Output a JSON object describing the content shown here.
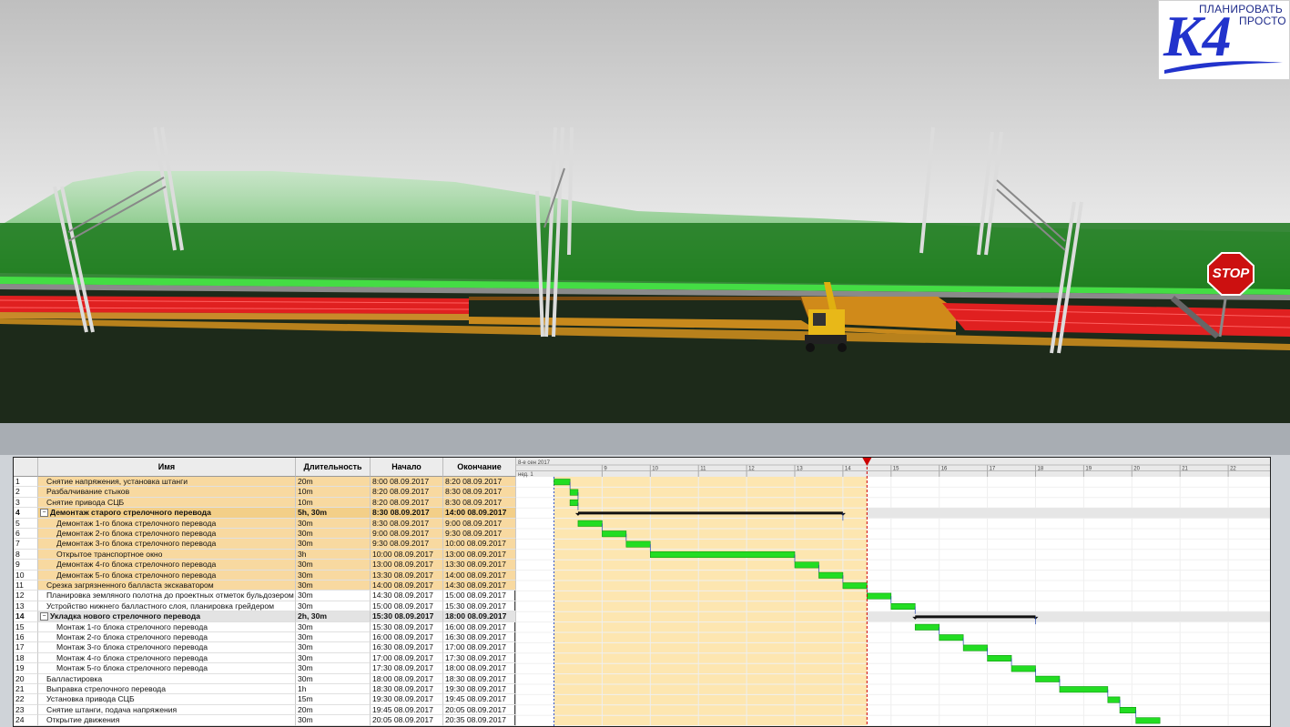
{
  "logo": {
    "line1": "ПЛАНИРОВАТЬ",
    "line2": "ПРОСТО",
    "mark": "K4"
  },
  "scene": {
    "sign_text": "STOP"
  },
  "columns": {
    "name": "Имя",
    "duration": "Длительность",
    "start": "Начало",
    "finish": "Окончание"
  },
  "timeline": {
    "date_label": "8-е сен 2017",
    "week_label": "нед. 1",
    "hours": [
      "9",
      "10",
      "11",
      "12",
      "13",
      "14",
      "15",
      "16",
      "17",
      "18",
      "19",
      "20",
      "21",
      "22"
    ]
  },
  "colors": {
    "past_band": "#fde6b0",
    "task_bar": "#22dd22",
    "summary_bar": "#111111",
    "today_line": "#cc0000"
  },
  "tasks": [
    {
      "id": "1",
      "name": "Снятие напряжения, установка штанги",
      "duration": "20m",
      "start": "8:00 08.09.2017",
      "finish": "8:20 08.09.2017",
      "level": 1,
      "summary": false,
      "past": true,
      "s": 0,
      "e": 20
    },
    {
      "id": "2",
      "name": "Разбалчивание стыков",
      "duration": "10m",
      "start": "8:20 08.09.2017",
      "finish": "8:30 08.09.2017",
      "level": 1,
      "summary": false,
      "past": true,
      "s": 20,
      "e": 30
    },
    {
      "id": "3",
      "name": "Снятие привода СЦБ",
      "duration": "10m",
      "start": "8:20 08.09.2017",
      "finish": "8:30 08.09.2017",
      "level": 1,
      "summary": false,
      "past": true,
      "s": 20,
      "e": 30
    },
    {
      "id": "4",
      "name": "Демонтаж старого стрелочного перевода",
      "duration": "5h, 30m",
      "start": "8:30 08.09.2017",
      "finish": "14:00 08.09.2017",
      "level": 0,
      "summary": true,
      "past": true,
      "s": 30,
      "e": 360
    },
    {
      "id": "5",
      "name": "Демонтаж 1-го блока стрелочного перевода",
      "duration": "30m",
      "start": "8:30 08.09.2017",
      "finish": "9:00 08.09.2017",
      "level": 2,
      "summary": false,
      "past": true,
      "s": 30,
      "e": 60
    },
    {
      "id": "6",
      "name": "Демонтаж 2-го блока стрелочного перевода",
      "duration": "30m",
      "start": "9:00 08.09.2017",
      "finish": "9:30 08.09.2017",
      "level": 2,
      "summary": false,
      "past": true,
      "s": 60,
      "e": 90
    },
    {
      "id": "7",
      "name": "Демонтаж 3-го блока стрелочного перевода",
      "duration": "30m",
      "start": "9:30 08.09.2017",
      "finish": "10:00 08.09.2017",
      "level": 2,
      "summary": false,
      "past": true,
      "s": 90,
      "e": 120
    },
    {
      "id": "8",
      "name": "Открытое транспортное окно",
      "duration": "3h",
      "start": "10:00 08.09.2017",
      "finish": "13:00 08.09.2017",
      "level": 2,
      "summary": false,
      "past": true,
      "s": 120,
      "e": 300
    },
    {
      "id": "9",
      "name": "Демонтаж 4-го блока стрелочного перевода",
      "duration": "30m",
      "start": "13:00 08.09.2017",
      "finish": "13:30 08.09.2017",
      "level": 2,
      "summary": false,
      "past": true,
      "s": 300,
      "e": 330
    },
    {
      "id": "10",
      "name": "Демонтаж 5-го блока стрелочного перевода",
      "duration": "30m",
      "start": "13:30 08.09.2017",
      "finish": "14:00 08.09.2017",
      "level": 2,
      "summary": false,
      "past": true,
      "s": 330,
      "e": 360
    },
    {
      "id": "11",
      "name": "Срезка загрязненного балласта экскаватором",
      "duration": "30m",
      "start": "14:00 08.09.2017",
      "finish": "14:30 08.09.2017",
      "level": 1,
      "summary": false,
      "past": true,
      "s": 360,
      "e": 390
    },
    {
      "id": "12",
      "name": "Планировка земляного полотна до проектных отметок бульдозером",
      "duration": "30m",
      "start": "14:30 08.09.2017",
      "finish": "15:00 08.09.2017",
      "level": 1,
      "summary": false,
      "past": false,
      "s": 390,
      "e": 420
    },
    {
      "id": "13",
      "name": "Устройство нижнего балластного слоя, планировка грейдером",
      "duration": "30m",
      "start": "15:00 08.09.2017",
      "finish": "15:30 08.09.2017",
      "level": 1,
      "summary": false,
      "past": false,
      "s": 420,
      "e": 450
    },
    {
      "id": "14",
      "name": "Укладка нового стрелочного перевода",
      "duration": "2h, 30m",
      "start": "15:30 08.09.2017",
      "finish": "18:00 08.09.2017",
      "level": 0,
      "summary": true,
      "past": false,
      "s": 450,
      "e": 600
    },
    {
      "id": "15",
      "name": "Монтаж 1-го блока стрелочного перевода",
      "duration": "30m",
      "start": "15:30 08.09.2017",
      "finish": "16:00 08.09.2017",
      "level": 2,
      "summary": false,
      "past": false,
      "s": 450,
      "e": 480
    },
    {
      "id": "16",
      "name": "Монтаж 2-го блока стрелочного перевода",
      "duration": "30m",
      "start": "16:00 08.09.2017",
      "finish": "16:30 08.09.2017",
      "level": 2,
      "summary": false,
      "past": false,
      "s": 480,
      "e": 510
    },
    {
      "id": "17",
      "name": "Монтаж 3-го блока стрелочного перевода",
      "duration": "30m",
      "start": "16:30 08.09.2017",
      "finish": "17:00 08.09.2017",
      "level": 2,
      "summary": false,
      "past": false,
      "s": 510,
      "e": 540
    },
    {
      "id": "18",
      "name": "Монтаж 4-го блока стрелочного перевода",
      "duration": "30m",
      "start": "17:00 08.09.2017",
      "finish": "17:30 08.09.2017",
      "level": 2,
      "summary": false,
      "past": false,
      "s": 540,
      "e": 570
    },
    {
      "id": "19",
      "name": "Монтаж 5-го блока стрелочного перевода",
      "duration": "30m",
      "start": "17:30 08.09.2017",
      "finish": "18:00 08.09.2017",
      "level": 2,
      "summary": false,
      "past": false,
      "s": 570,
      "e": 600
    },
    {
      "id": "20",
      "name": "Балластировка",
      "duration": "30m",
      "start": "18:00 08.09.2017",
      "finish": "18:30 08.09.2017",
      "level": 1,
      "summary": false,
      "past": false,
      "s": 600,
      "e": 630
    },
    {
      "id": "21",
      "name": "Выправка стрелочного перевода",
      "duration": "1h",
      "start": "18:30 08.09.2017",
      "finish": "19:30 08.09.2017",
      "level": 1,
      "summary": false,
      "past": false,
      "s": 630,
      "e": 690
    },
    {
      "id": "22",
      "name": "Установка привода СЦБ",
      "duration": "15m",
      "start": "19:30 08.09.2017",
      "finish": "19:45 08.09.2017",
      "level": 1,
      "summary": false,
      "past": false,
      "s": 690,
      "e": 705
    },
    {
      "id": "23",
      "name": "Снятие штанги, подача напряжения",
      "duration": "20m",
      "start": "19:45 08.09.2017",
      "finish": "20:05 08.09.2017",
      "level": 1,
      "summary": false,
      "past": false,
      "s": 705,
      "e": 725
    },
    {
      "id": "24",
      "name": "Открытие движения",
      "duration": "30m",
      "start": "20:05 08.09.2017",
      "finish": "20:35 08.09.2017",
      "level": 1,
      "summary": false,
      "past": false,
      "s": 725,
      "e": 755
    }
  ]
}
